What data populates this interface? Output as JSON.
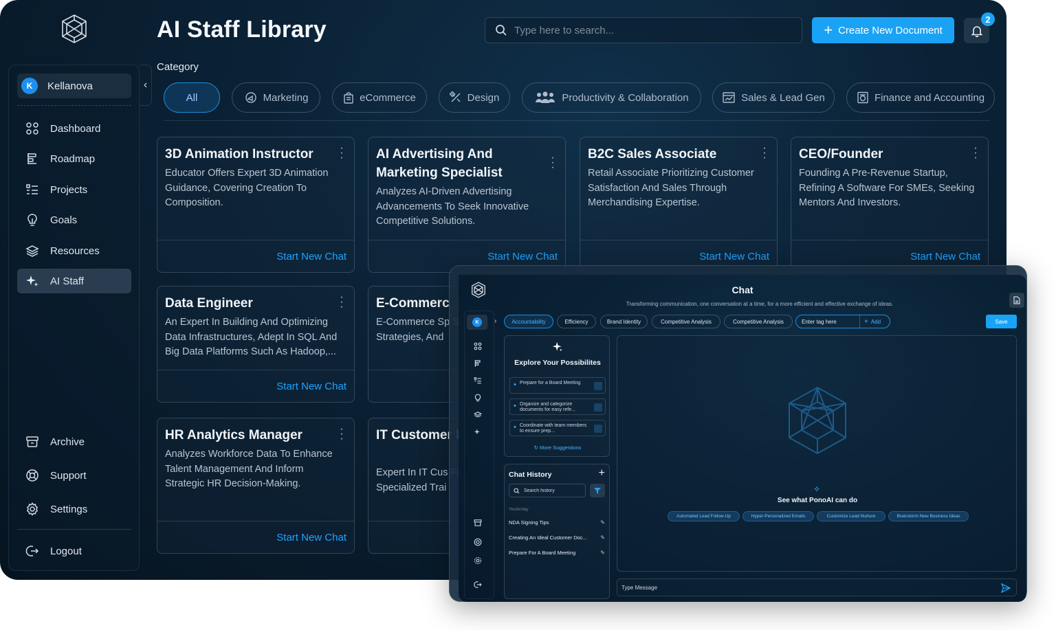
{
  "header": {
    "title": "AI Staff Library",
    "search_placeholder": "Type here to search...",
    "create_label": "Create New Document",
    "notification_count": "2"
  },
  "sidebar": {
    "org_initial": "K",
    "org_name": "Kellanova",
    "items": [
      {
        "label": "Dashboard",
        "icon": "grid-icon"
      },
      {
        "label": "Roadmap",
        "icon": "roadmap-icon"
      },
      {
        "label": "Projects",
        "icon": "list-icon"
      },
      {
        "label": "Goals",
        "icon": "lightbulb-icon"
      },
      {
        "label": "Resources",
        "icon": "layers-icon"
      },
      {
        "label": "AI Staff",
        "icon": "sparkle-icon",
        "active": true
      }
    ],
    "bottom_items": [
      {
        "label": "Archive",
        "icon": "archive-icon"
      },
      {
        "label": "Support",
        "icon": "lifebuoy-icon"
      },
      {
        "label": "Settings",
        "icon": "gear-icon"
      }
    ],
    "logout_label": "Logout"
  },
  "categories": {
    "label": "Category",
    "items": [
      "All",
      "Marketing",
      "eCommerce",
      "Design",
      "Productivity & Collaboration",
      "Sales & Lead Gen",
      "Finance and Accounting"
    ]
  },
  "cards": [
    {
      "title": "3D Animation Instructor",
      "desc": "Educator Offers Expert 3D Animation Guidance, Covering Creation To Composition.",
      "cta": "Start New Chat"
    },
    {
      "title": "AI Advertising And Marketing Specialist",
      "desc": "Analyzes AI-Driven Advertising Advancements To Seek Innovative Competitive Solutions.",
      "cta": "Start New Chat"
    },
    {
      "title": "B2C Sales Associate",
      "desc": "Retail Associate Prioritizing Customer Satisfaction And Sales Through Merchandising Expertise.",
      "cta": "Start New Chat"
    },
    {
      "title": "CEO/Founder",
      "desc": "Founding A Pre-Revenue Startup, Refining A Software For SMEs, Seeking Mentors And Investors.",
      "cta": "Start New Chat"
    },
    {
      "title": "Data Engineer",
      "desc": "An Expert In Building And Optimizing Data Infrastructures, Adept In SQL And Big Data Platforms Such As Hadoop,...",
      "cta": "Start New Chat"
    },
    {
      "title": "E-Commerc",
      "desc": "E-Commerce Sp Sales Pathways Strategies, And",
      "cta": ""
    },
    {
      "title": "HR Analytics Manager",
      "desc": "Analyzes Workforce Data To Enhance Talent Management And Inform Strategic HR Decision-Making.",
      "cta": "Start New Chat"
    },
    {
      "title": "IT Customer Representat",
      "desc": "Expert In IT Cus Focused On Sat Specialized Trai",
      "cta": ""
    }
  ],
  "chat": {
    "title": "Chat",
    "subtitle": "Transforming communication, one conversation at a time, for a more efficient and effective exchange of ideas.",
    "rail_initial": "K",
    "tags": [
      "Accountability",
      "Efficiency",
      "Brand Identity",
      "Competitive Analysis",
      "Competitive Analysis"
    ],
    "tag_input_placeholder": "Enter tag here",
    "tag_add_label": "Add",
    "save_label": "Save",
    "explore_title": "Explore Your Possibilites",
    "suggestions": [
      "Prepare for a Board Meeting",
      "Organize and categorize documents for easy refe...",
      "Coordinate with team members to ensure prep..."
    ],
    "more_suggestions": "More Suggestions",
    "history_title": "Chat History",
    "history_search_placeholder": "Search history",
    "history_group": "Yesterday",
    "history_items": [
      "NDA Signing Tips",
      "Creating An Ideal Customer Doc...",
      "Prepare For A Board Meeting"
    ],
    "see_what": "See what PonoAI can do",
    "pills": [
      "Automated Lead Follow-Up",
      "Hyper-Personalized Emails",
      "Customize Lead Nurture",
      "Brainstorm New Business Ideas"
    ],
    "message_placeholder": "Type Message"
  },
  "colors": {
    "accent": "#1aa3f5",
    "link": "#1ea4ff",
    "background": "#0b2236"
  }
}
